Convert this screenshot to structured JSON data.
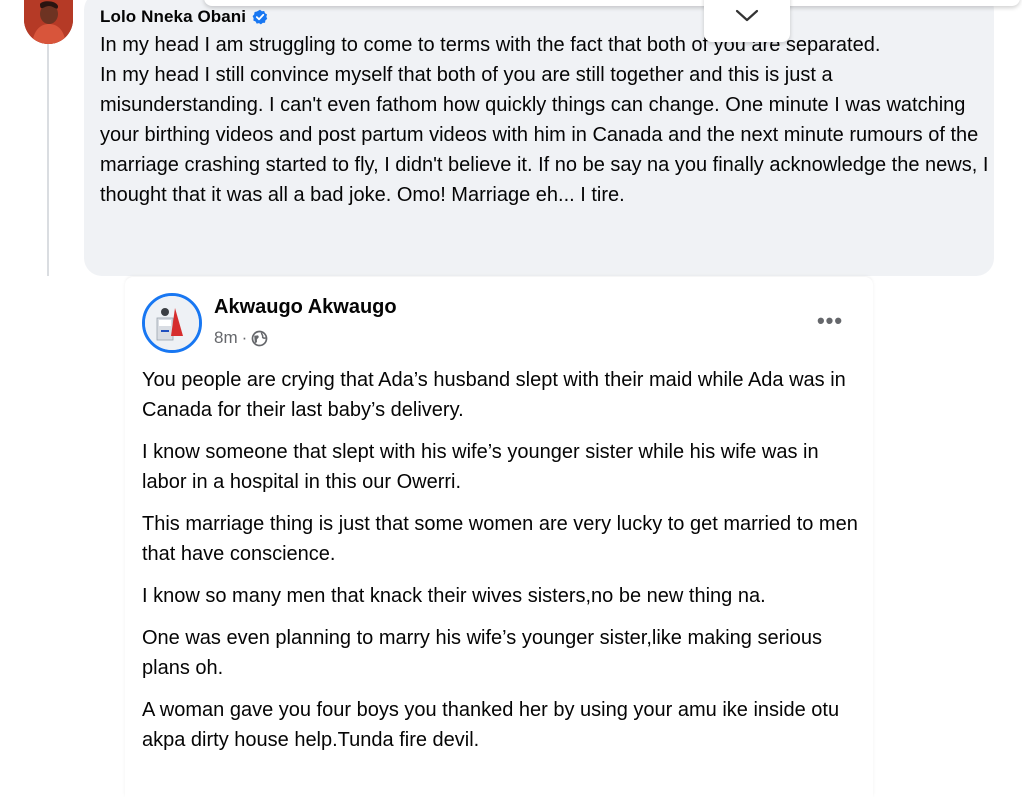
{
  "comment": {
    "author": "Lolo Nneka Obani",
    "verified_icon": "verified-badge-icon",
    "text": "In my head I am struggling to come to terms with the fact that both of you are separated.\nIn my head I still convince myself that both of you are still together and this is just a misunderstanding. I can't even fathom how quickly things can change. One minute I was watching your birthing videos and post partum videos with him in Canada and the next minute rumours of the marriage crashing started to fly, I didn't believe it. If no be say na you finally acknowledge the news, I thought that it was all a bad joke. Omo! Marriage eh... I tire."
  },
  "collapse_icon": "chevron-down-icon",
  "shared_post": {
    "author": "Akwaugo Akwaugo",
    "time": "8m",
    "separator": "·",
    "privacy_icon": "globe-icon",
    "more_label": "•••",
    "paragraphs": [
      "You people are crying that Ada’s husband slept with their maid while Ada was in Canada for their last baby’s delivery.",
      "I know someone that slept with his wife’s younger sister while his wife was in labor in a hospital in this our Owerri.",
      "This marriage thing is just that some women are very lucky to get married to men that have conscience.",
      "I know so many men that knack their wives sisters,no be new thing na.",
      "One was even planning to marry his wife’s younger sister,like making serious plans oh.",
      "A woman gave you four boys you thanked her by using your amu ike inside otu akpa dirty house help.Tunda fire devil."
    ]
  },
  "colors": {
    "bubble_bg": "#f0f2f5",
    "text": "#050505",
    "meta": "#65676b",
    "verified": "#1877f2",
    "avatar_ring": "#1877f2"
  }
}
